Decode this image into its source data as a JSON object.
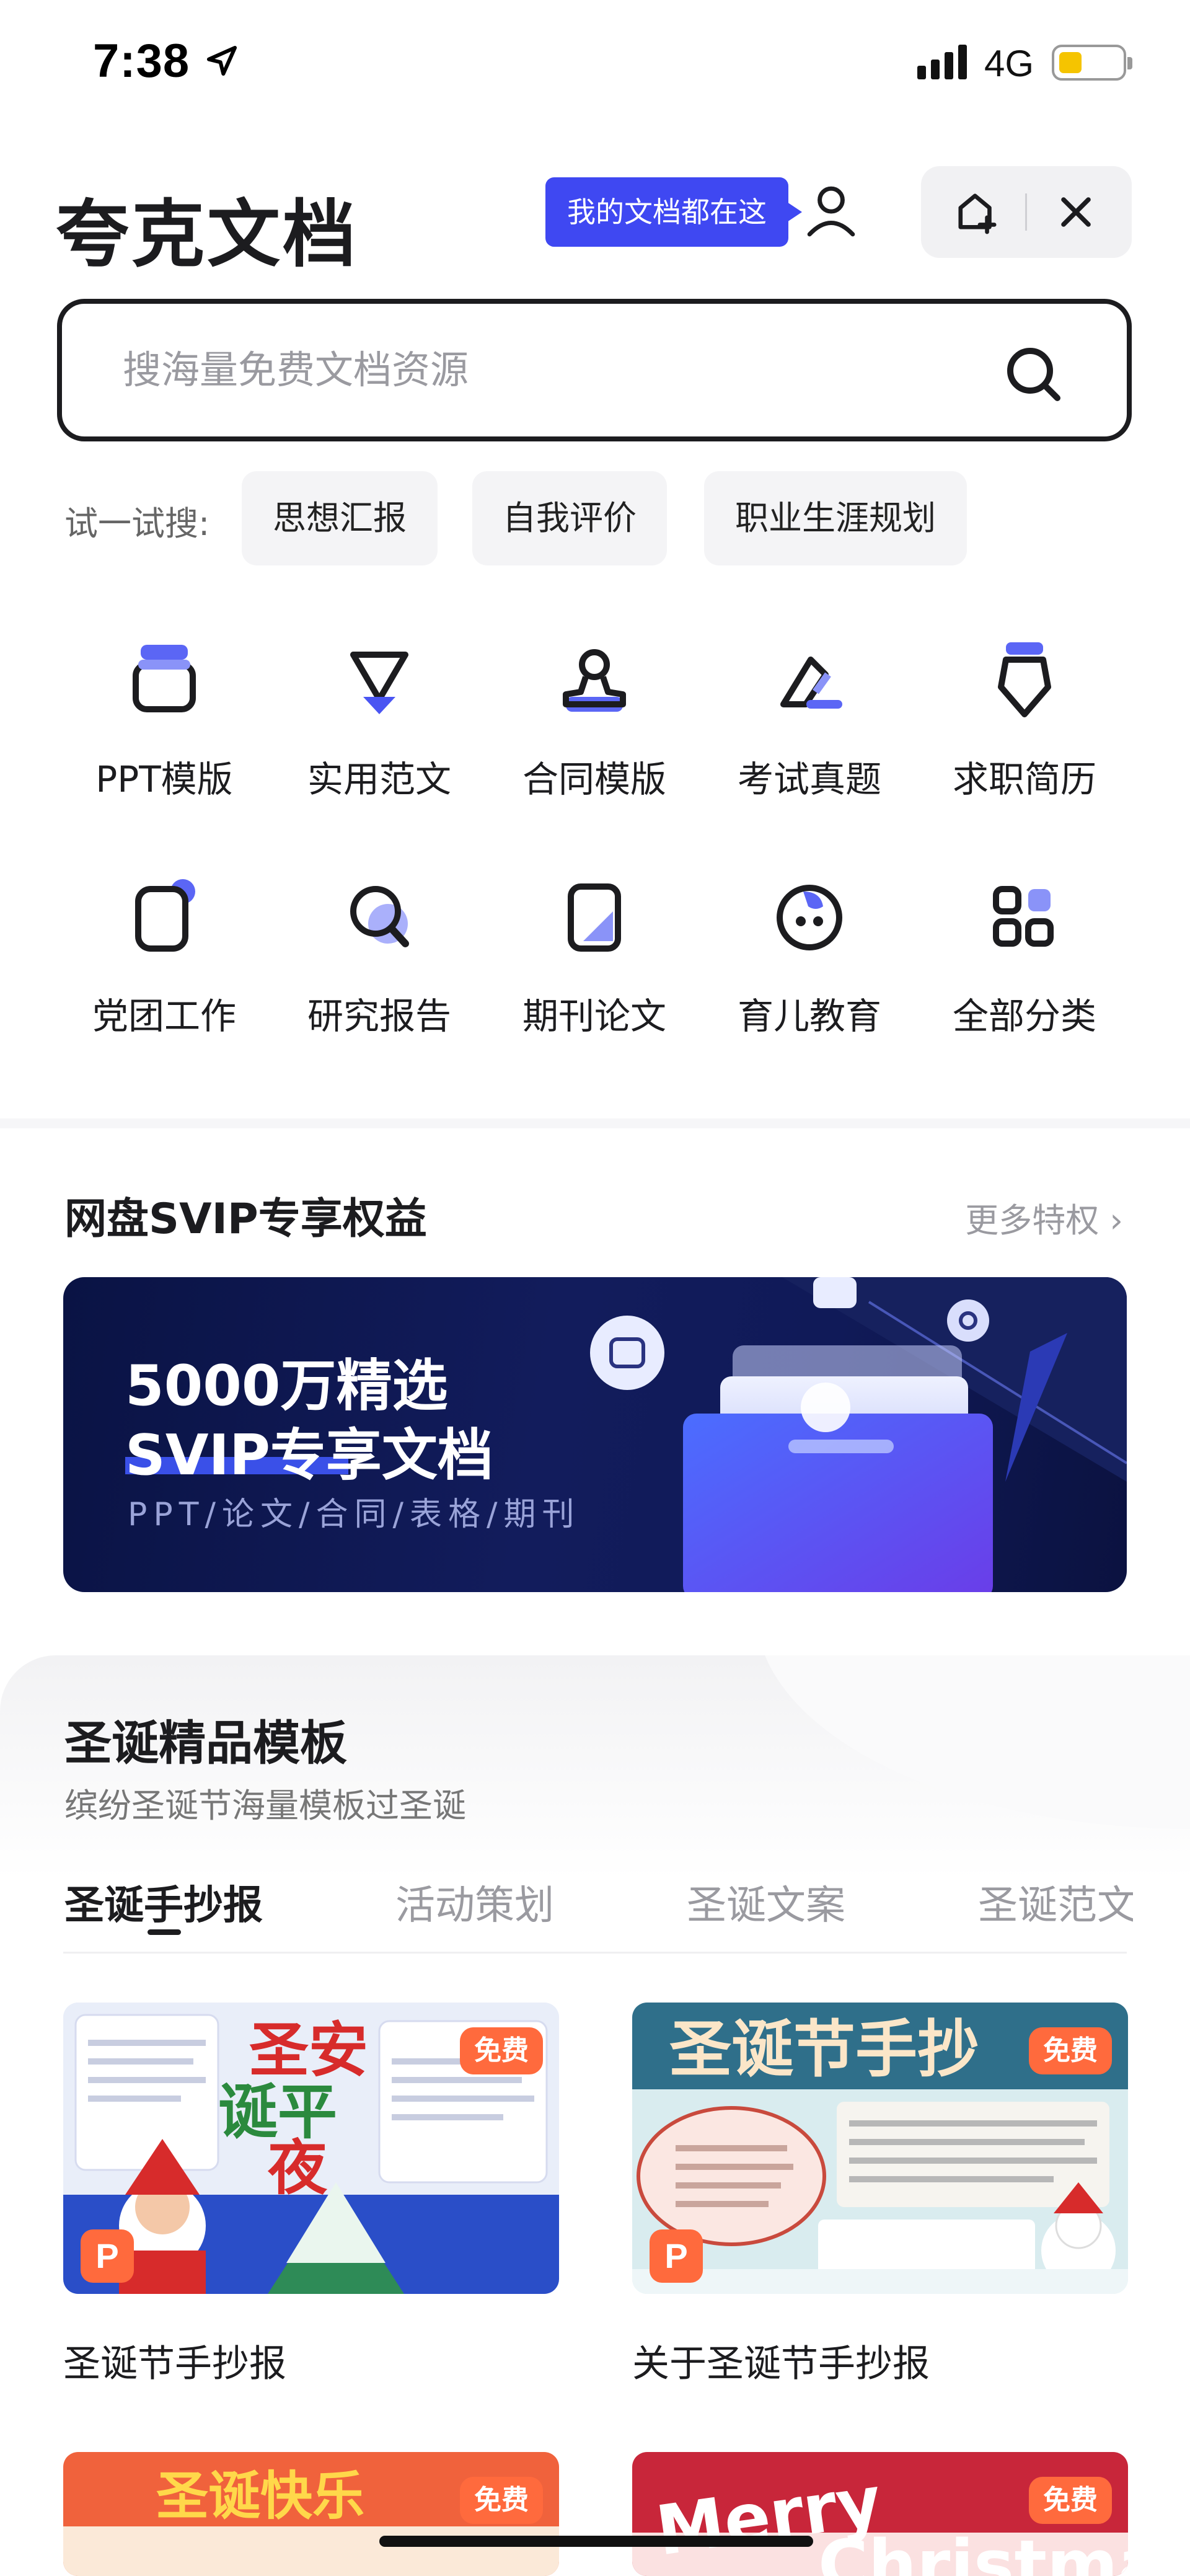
{
  "status_bar": {
    "time": "7:38",
    "network": "4G",
    "battery_level": 0.35
  },
  "header": {
    "brand": "夸克文档",
    "tip": "我的文档都在这"
  },
  "search": {
    "placeholder": "搜海量免费文档资源",
    "value": ""
  },
  "try_search": {
    "label": "试一试搜:",
    "chips": [
      "思想汇报",
      "自我评价",
      "职业生涯规划"
    ]
  },
  "categories": [
    {
      "label": "PPT模版",
      "icon": "ppt-template-icon"
    },
    {
      "label": "实用范文",
      "icon": "practical-essay-icon"
    },
    {
      "label": "合同模版",
      "icon": "contract-template-icon"
    },
    {
      "label": "考试真题",
      "icon": "exam-paper-icon"
    },
    {
      "label": "求职简历",
      "icon": "resume-icon"
    },
    {
      "label": "党团工作",
      "icon": "party-work-icon"
    },
    {
      "label": "研究报告",
      "icon": "research-report-icon"
    },
    {
      "label": "期刊论文",
      "icon": "journal-paper-icon"
    },
    {
      "label": "育儿教育",
      "icon": "parenting-icon"
    },
    {
      "label": "全部分类",
      "icon": "all-categories-icon"
    }
  ],
  "svip": {
    "title": "网盘SVIP专享权益",
    "more": "更多特权 ›",
    "banner_line1": "5000万精选",
    "banner_line2": "SVIP专享文档",
    "banner_line3": "PPT/论文/合同/表格/期刊"
  },
  "christmas": {
    "title": "圣诞精品模板",
    "subtitle": "缤纷圣诞节海量模板过圣诞",
    "tabs": [
      "圣诞手抄报",
      "活动策划",
      "圣诞文案",
      "圣诞范文"
    ],
    "active_tab": 0,
    "cards": [
      {
        "title": "圣诞节手抄报",
        "badge": "免费",
        "type_badge": "P",
        "thumb_text": "圣诞平安夜"
      },
      {
        "title": "关于圣诞节手抄报",
        "badge": "免费",
        "type_badge": "P",
        "thumb_text": "圣诞节手抄"
      },
      {
        "badge": "免费",
        "thumb_text": "圣诞快乐"
      },
      {
        "badge": "免费",
        "thumb_text": "Merry Christmas"
      }
    ]
  },
  "colors": {
    "accent": "#3f48f2",
    "badge": "#ff6a3d",
    "text": "#1c1c1f",
    "muted": "#9a9aa0"
  }
}
